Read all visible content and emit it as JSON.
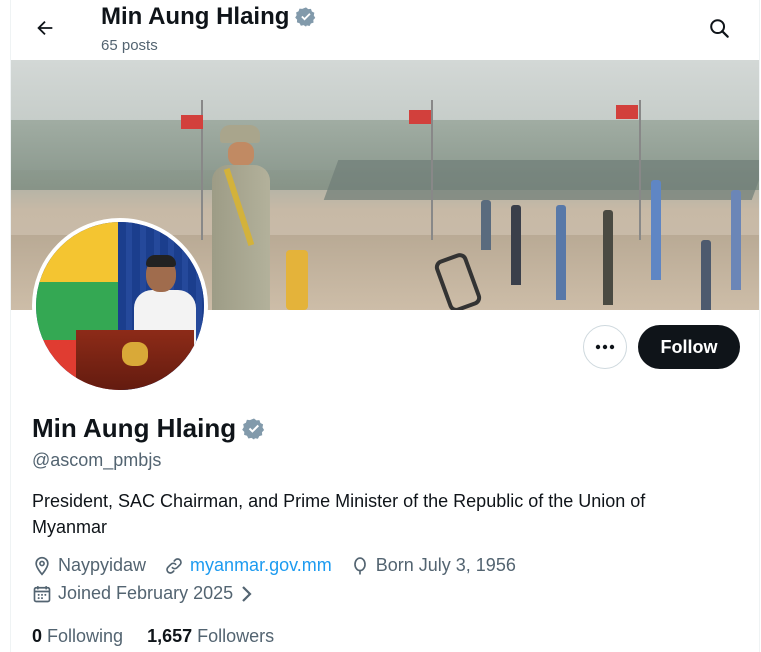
{
  "header": {
    "title": "Min Aung Hlaing",
    "posts": "65 posts"
  },
  "actions": {
    "follow_label": "Follow"
  },
  "profile": {
    "display_name": "Min Aung Hlaing",
    "handle": "@ascom_pmbjs",
    "bio": "President, SAC Chairman, and Prime Minister of the Republic of the Union of Myanmar",
    "location": "Naypyidaw",
    "website": "myanmar.gov.mm",
    "birthday": "Born July 3, 1956",
    "joined": "Joined February 2025",
    "following_count": "0",
    "following_label": "Following",
    "followers_count": "1,657",
    "followers_label": "Followers"
  },
  "colors": {
    "accent": "#1d9bf0",
    "verified_badge": "#829aab",
    "text_primary": "#0f1419",
    "text_secondary": "#536471"
  },
  "icons": [
    "back-arrow-icon",
    "verified-badge-icon",
    "search-icon",
    "more-icon",
    "location-icon",
    "link-icon",
    "birthday-icon",
    "calendar-icon",
    "chevron-right-icon"
  ]
}
